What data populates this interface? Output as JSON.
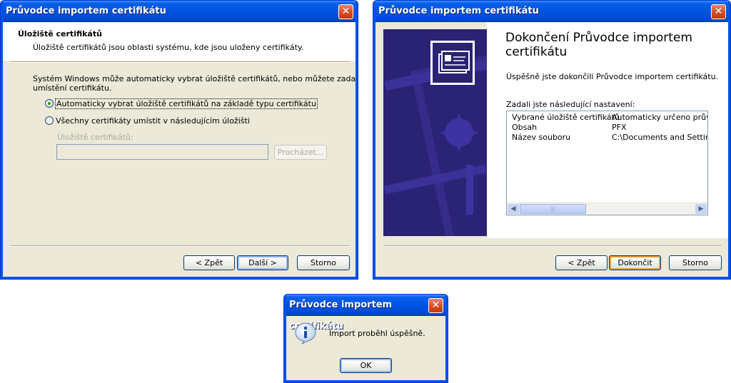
{
  "dialog1": {
    "title": "Průvodce importem certifikátu",
    "heading": "Úložiště certifikátů",
    "subheading": "Úložiště certifikátů jsou oblasti systému, kde jsou uloženy certifikáty.",
    "body_line1": "Systém Windows může automaticky vybrat úložiště certifikátů, nebo můžete zadat",
    "body_line2": "umístění certifikátu.",
    "radio_auto": "Automaticky vybrat úložiště certifikátů na základě typu certifikátu",
    "radio_manual": "Všechny certifikáty umístit v následujícím úložišti",
    "store_label": "Úložiště certifikátů:",
    "store_value": "",
    "browse_label": "Procházet...",
    "back_label": "< Zpět",
    "next_label": "Další >",
    "cancel_label": "Storno"
  },
  "dialog2": {
    "title": "Průvodce importem certifikátu",
    "heading_line1": "Dokončení Průvodce importem",
    "heading_line2": "certifikátu",
    "success_text": "Úspěšně jste dokončili Průvodce importem certifikátu.",
    "settings_label": "Zadali jste následující nastavení:",
    "settings": [
      {
        "name": "Vybrané úložiště certifikátů",
        "value": "Automaticky určeno průvodc"
      },
      {
        "name": "Obsah",
        "value": "PFX"
      },
      {
        "name": "Název souboru",
        "value": "C:\\Documents and Settings\\"
      }
    ],
    "back_label": "< Zpět",
    "finish_label": "Dokončit",
    "cancel_label": "Storno"
  },
  "dialog3": {
    "title": "Průvodce importem certifikátu",
    "message": "Import proběhl úspěšně.",
    "ok_label": "OK"
  },
  "icons": {
    "info": "info-icon",
    "close": "close-icon",
    "certificate": "certificate-icon"
  },
  "colors": {
    "titlebar": "#0054e3",
    "dialog_bg": "#ece9d8",
    "banner": "#2a2273",
    "close": "#d6491e"
  }
}
